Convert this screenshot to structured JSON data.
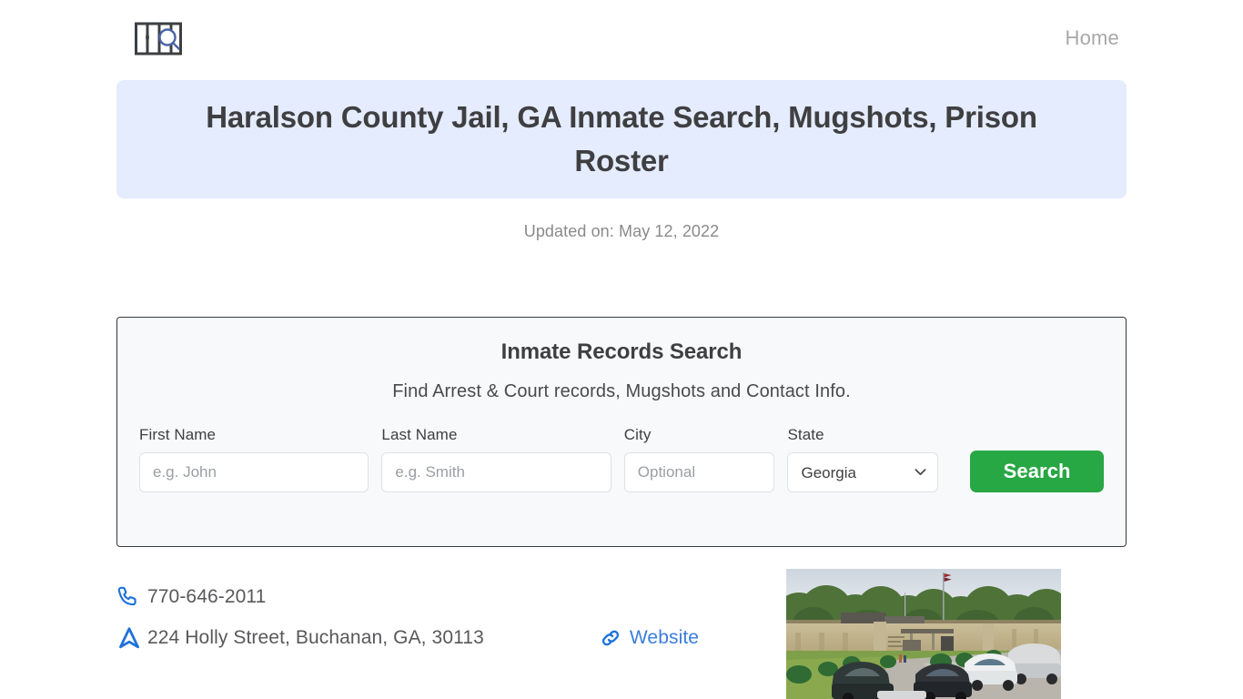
{
  "header": {
    "logo_name": "jail-bars-magnifier-logo",
    "nav": [
      {
        "label": "Home"
      }
    ]
  },
  "banner": {
    "title": "Haralson County Jail, GA Inmate Search, Mugshots, Prison Roster",
    "background_color": "#e4ecfd"
  },
  "updated": {
    "text": "Updated on: May 12, 2022"
  },
  "search_card": {
    "title": "Inmate Records Search",
    "subtitle": "Find Arrest & Court records, Mugshots and Contact Info.",
    "fields": [
      {
        "label": "First Name",
        "placeholder": "e.g. John",
        "value": ""
      },
      {
        "label": "Last Name",
        "placeholder": "e.g. Smith",
        "value": ""
      },
      {
        "label": "City",
        "placeholder": "Optional",
        "value": ""
      }
    ],
    "state": {
      "label": "State",
      "selected": "Georgia",
      "options": [
        "Georgia"
      ]
    },
    "submit_label": "Search",
    "submit_color": "#28a745"
  },
  "contact": {
    "phone": "770-646-2011",
    "address": "224 Holly Street, Buchanan, GA, 30113",
    "website_label": "Website",
    "link_color": "#3b7ddd"
  },
  "photo": {
    "alt": "Haralson County Jail building exterior with parked cars and flagpole"
  }
}
